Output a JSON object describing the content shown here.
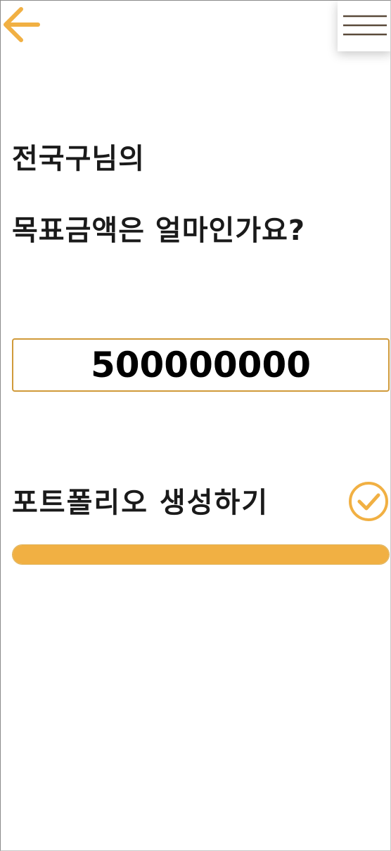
{
  "header": {
    "back_icon": "arrow-left-icon",
    "menu_icon": "hamburger-menu-icon"
  },
  "title": {
    "line1": "전국구님의",
    "line2": "목표금액은 얼마인가요?"
  },
  "goal_amount": {
    "value": "500000000"
  },
  "action": {
    "label": "포트폴리오 생성하기",
    "icon": "check-circle-icon"
  },
  "progress": {
    "percent": 100
  },
  "colors": {
    "accent": "#f1b043",
    "input_border": "#d09a3a",
    "menu_line": "#5a4a3a"
  }
}
